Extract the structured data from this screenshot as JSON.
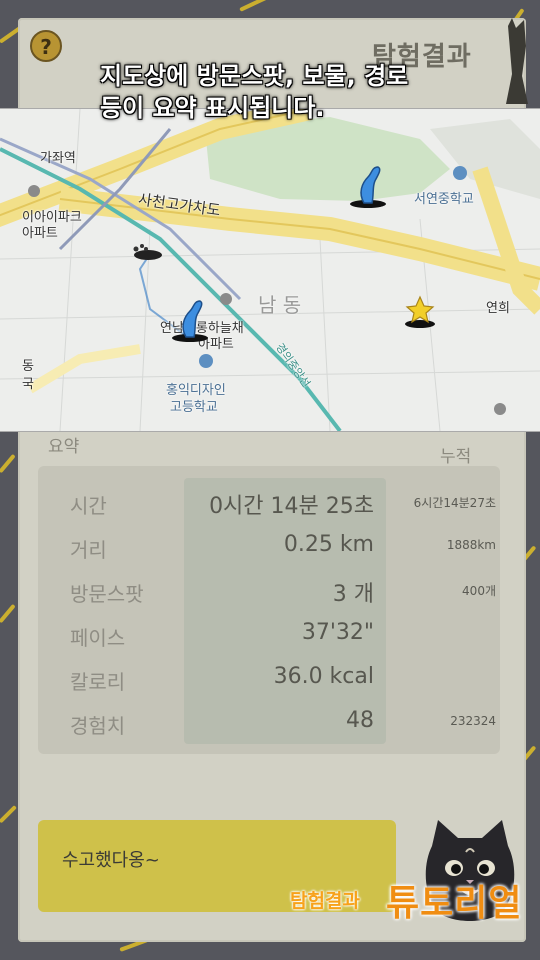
{
  "header": {
    "help_icon": "?",
    "title": "탐험결과"
  },
  "tutorial_caption": {
    "line1": "지도상에 방문스팟, 보물, 경로",
    "line2": "등이 요약 표시됩니다."
  },
  "map": {
    "labels": {
      "gajwa_station": "가좌역",
      "ipark_1": "이아이파크",
      "ipark_2": "아파트",
      "sacheon_road": "사천고가차도",
      "seoyeon_school": "서연중학교",
      "yeonnam_dong": "남 동",
      "yeonhui": "연희",
      "apt_1": "연남오롱하늘채",
      "apt_2": "아파트",
      "hongik_1": "홍익디자인",
      "hongik_2": "고등학교",
      "gyeongui_line": "경의중앙선",
      "dong_1": "동",
      "dong_2": "국"
    }
  },
  "summary": {
    "title": "요약",
    "cumulative_header": "누적",
    "rows": [
      {
        "label": "시간",
        "value": "0시간 14분 25초",
        "total": "6시간14분27초"
      },
      {
        "label": "거리",
        "value": "0.25 km",
        "total": "1888km"
      },
      {
        "label": "방문스팟",
        "value": "3 개",
        "total": "400개"
      },
      {
        "label": "페이스",
        "value": "37'32\"",
        "total": ""
      },
      {
        "label": "칼로리",
        "value": "36.0 kcal",
        "total": ""
      },
      {
        "label": "경험치",
        "value": "48",
        "total": "232324"
      }
    ]
  },
  "message": {
    "text": "수고했다옹~"
  },
  "footer": {
    "small": "탐험결과",
    "big": "튜토리얼"
  },
  "colors": {
    "background": "#55565d",
    "panel": "#d2d1c5",
    "accent_yellow": "#d8b92a",
    "route_blue": "#2f78c4",
    "footer_orange": "#f08d12"
  }
}
